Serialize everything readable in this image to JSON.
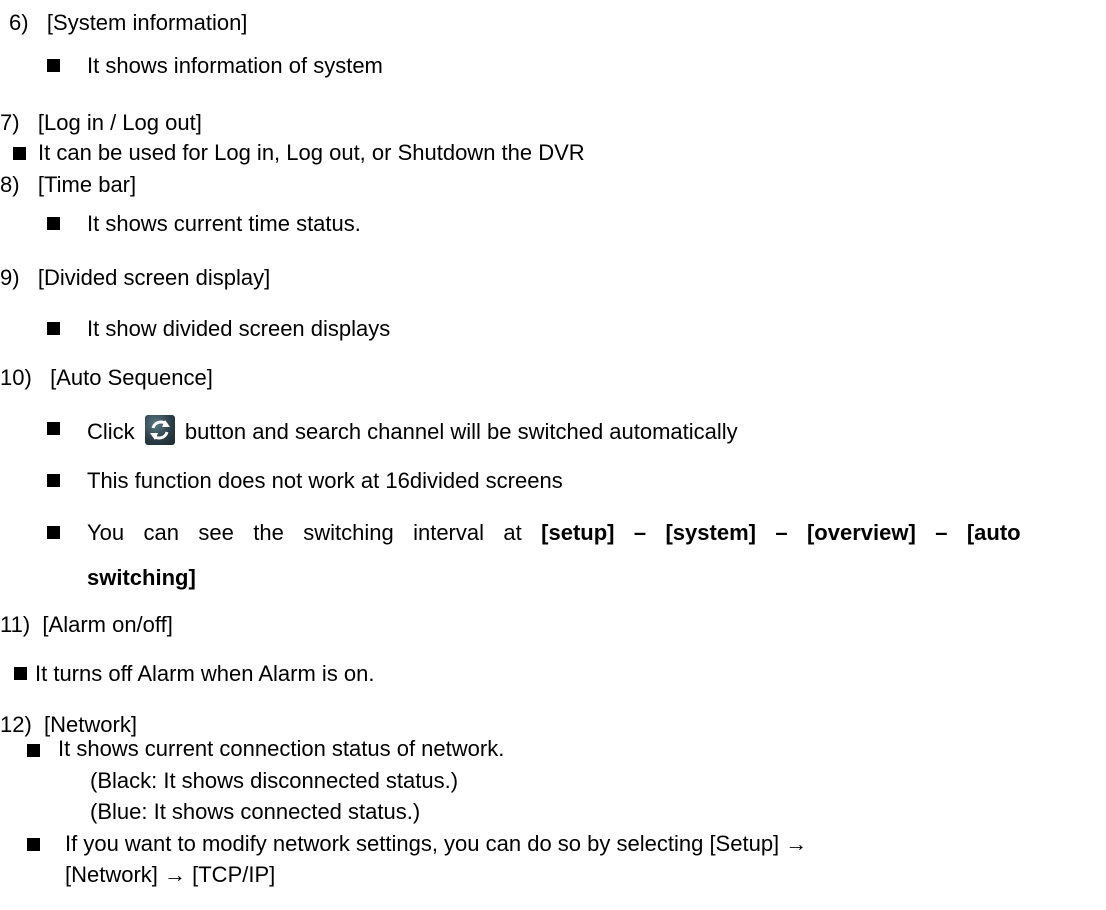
{
  "items": [
    {
      "num": "6)",
      "title": "[System information]",
      "bullets": [
        "It shows information of system"
      ]
    },
    {
      "num": "7)",
      "title": "[Log in / Log out]",
      "bullets": [
        "It can be used for Log in, Log out, or Shutdown the DVR"
      ]
    },
    {
      "num": "8)",
      "title": "[Time bar]",
      "bullets": [
        "It shows current time status."
      ]
    },
    {
      "num": "9)",
      "title": "[Divided screen display]",
      "bullets": [
        "It show divided screen displays"
      ]
    },
    {
      "num": "10)",
      "title": "[Auto Sequence]",
      "bullet1_pre": "Click",
      "bullet1_icon": "refresh-icon",
      "bullet1_post": "button and search channel will be switched automatically",
      "bullet2": "This function does not work at 16divided screens",
      "bullet3_pre": "You can see the switching interval at",
      "bullet3_bold_line1": "[setup] – [system] – [overview] – [auto",
      "bullet3_bold_line2": "switching]"
    },
    {
      "num": "11)",
      "title": "[Alarm on/off]",
      "bullets": [
        "It turns off Alarm when Alarm is on."
      ]
    },
    {
      "num": "12)",
      "title": "[Network]",
      "bullet1": "It shows current connection status of network.",
      "sub1": "(Black: It shows disconnected status.)",
      "sub2": "(Blue: It shows connected status.)",
      "bullet2_line1": "If you want to modify network settings, you can do so by selecting [Setup] →",
      "bullet2_line2": "[Network] → [TCP/IP]"
    }
  ],
  "colors": {
    "text": "#000000",
    "background": "#ffffff"
  }
}
